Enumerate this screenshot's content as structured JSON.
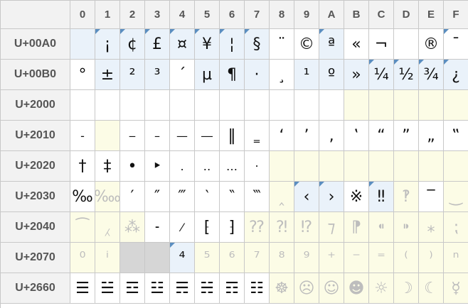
{
  "columns": [
    "0",
    "1",
    "2",
    "3",
    "4",
    "5",
    "6",
    "7",
    "8",
    "9",
    "A",
    "B",
    "C",
    "D",
    "E",
    "F"
  ],
  "rows": [
    {
      "label": "U+00A0",
      "cells": [
        {
          "glyph": "",
          "state": "mod",
          "marked": false
        },
        {
          "glyph": "¡",
          "state": "mod",
          "marked": true
        },
        {
          "glyph": "¢",
          "state": "mod",
          "marked": true
        },
        {
          "glyph": "£",
          "state": "mod",
          "marked": true
        },
        {
          "glyph": "¤",
          "state": "mod",
          "marked": true
        },
        {
          "glyph": "¥",
          "state": "mod",
          "marked": true
        },
        {
          "glyph": "¦",
          "state": "mod",
          "marked": true
        },
        {
          "glyph": "§",
          "state": "mod",
          "marked": true
        },
        {
          "glyph": "¨",
          "state": "plain",
          "marked": false
        },
        {
          "glyph": "©",
          "state": "plain",
          "marked": false
        },
        {
          "glyph": "ª",
          "state": "mod",
          "marked": true
        },
        {
          "glyph": "«",
          "state": "plain",
          "marked": false
        },
        {
          "glyph": "¬",
          "state": "plain",
          "marked": false
        },
        {
          "glyph": "",
          "state": "plain",
          "marked": false
        },
        {
          "glyph": "®",
          "state": "plain",
          "marked": false
        },
        {
          "glyph": "¯",
          "state": "plain",
          "marked": true
        }
      ]
    },
    {
      "label": "U+00B0",
      "cells": [
        {
          "glyph": "°",
          "state": "plain",
          "marked": false
        },
        {
          "glyph": "±",
          "state": "mod",
          "marked": false
        },
        {
          "glyph": "²",
          "state": "mod",
          "marked": false
        },
        {
          "glyph": "³",
          "state": "mod",
          "marked": false
        },
        {
          "glyph": "´",
          "state": "plain",
          "marked": false
        },
        {
          "glyph": "µ",
          "state": "mod",
          "marked": false
        },
        {
          "glyph": "¶",
          "state": "mod",
          "marked": false
        },
        {
          "glyph": "·",
          "state": "mod",
          "marked": false
        },
        {
          "glyph": "¸",
          "state": "plain",
          "marked": false
        },
        {
          "glyph": "¹",
          "state": "mod",
          "marked": false
        },
        {
          "glyph": "º",
          "state": "mod",
          "marked": false
        },
        {
          "glyph": "»",
          "state": "mod",
          "marked": false
        },
        {
          "glyph": "¼",
          "state": "mod",
          "marked": true
        },
        {
          "glyph": "½",
          "state": "mod",
          "marked": true
        },
        {
          "glyph": "¾",
          "state": "mod",
          "marked": true
        },
        {
          "glyph": "¿",
          "state": "mod",
          "marked": true
        }
      ]
    },
    {
      "label": "U+2000",
      "cells": [
        {
          "glyph": "",
          "state": "plain",
          "marked": false
        },
        {
          "glyph": "",
          "state": "plain",
          "marked": false
        },
        {
          "glyph": "",
          "state": "plain",
          "marked": false
        },
        {
          "glyph": "",
          "state": "plain",
          "marked": false
        },
        {
          "glyph": "",
          "state": "plain",
          "marked": false
        },
        {
          "glyph": "",
          "state": "plain",
          "marked": false
        },
        {
          "glyph": "",
          "state": "plain",
          "marked": false
        },
        {
          "glyph": "",
          "state": "plain",
          "marked": false
        },
        {
          "glyph": "",
          "state": "plain",
          "marked": false
        },
        {
          "glyph": "",
          "state": "plain",
          "marked": false
        },
        {
          "glyph": "",
          "state": "plain",
          "marked": false
        },
        {
          "glyph": "",
          "state": "unass",
          "marked": false
        },
        {
          "glyph": "",
          "state": "unass",
          "marked": false
        },
        {
          "glyph": "",
          "state": "unass",
          "marked": false
        },
        {
          "glyph": "",
          "state": "unass",
          "marked": false
        },
        {
          "glyph": "",
          "state": "unass",
          "marked": false
        }
      ]
    },
    {
      "label": "U+2010",
      "cells": [
        {
          "glyph": "‐",
          "state": "plain",
          "marked": false
        },
        {
          "glyph": "",
          "state": "unass",
          "marked": false
        },
        {
          "glyph": "‒",
          "state": "plain",
          "marked": false
        },
        {
          "glyph": "–",
          "state": "plain",
          "marked": false
        },
        {
          "glyph": "—",
          "state": "plain",
          "marked": false
        },
        {
          "glyph": "―",
          "state": "plain",
          "marked": false
        },
        {
          "glyph": "‖",
          "state": "plain",
          "marked": false
        },
        {
          "glyph": "‗",
          "state": "plain",
          "marked": false
        },
        {
          "glyph": "‘",
          "state": "plain",
          "marked": false
        },
        {
          "glyph": "’",
          "state": "plain",
          "marked": false
        },
        {
          "glyph": "‚",
          "state": "plain",
          "marked": false
        },
        {
          "glyph": "‛",
          "state": "plain",
          "marked": false
        },
        {
          "glyph": "“",
          "state": "plain",
          "marked": false
        },
        {
          "glyph": "”",
          "state": "plain",
          "marked": false
        },
        {
          "glyph": "„",
          "state": "plain",
          "marked": false
        },
        {
          "glyph": "‟",
          "state": "plain",
          "marked": false
        }
      ]
    },
    {
      "label": "U+2020",
      "cells": [
        {
          "glyph": "†",
          "state": "plain",
          "marked": false
        },
        {
          "glyph": "‡",
          "state": "plain",
          "marked": false
        },
        {
          "glyph": "•",
          "state": "plain",
          "marked": false
        },
        {
          "glyph": "‣",
          "state": "plain",
          "marked": false
        },
        {
          "glyph": "․",
          "state": "plain",
          "marked": false
        },
        {
          "glyph": "‥",
          "state": "plain",
          "marked": false
        },
        {
          "glyph": "…",
          "state": "plain",
          "marked": false
        },
        {
          "glyph": "‧",
          "state": "plain",
          "marked": false
        },
        {
          "glyph": "",
          "state": "unass",
          "marked": false
        },
        {
          "glyph": "",
          "state": "unass",
          "marked": false
        },
        {
          "glyph": "",
          "state": "unass",
          "marked": false
        },
        {
          "glyph": "",
          "state": "unass",
          "marked": false
        },
        {
          "glyph": "",
          "state": "unass",
          "marked": false
        },
        {
          "glyph": "",
          "state": "unass",
          "marked": false
        },
        {
          "glyph": "",
          "state": "unass",
          "marked": false
        },
        {
          "glyph": "",
          "state": "unass",
          "marked": false
        }
      ]
    },
    {
      "label": "U+2030",
      "cells": [
        {
          "glyph": "‰",
          "state": "plain",
          "marked": false
        },
        {
          "glyph": "‱",
          "state": "unass",
          "marked": false
        },
        {
          "glyph": "′",
          "state": "plain",
          "marked": false
        },
        {
          "glyph": "″",
          "state": "plain",
          "marked": false
        },
        {
          "glyph": "‴",
          "state": "plain",
          "marked": false
        },
        {
          "glyph": "‵",
          "state": "plain",
          "marked": false
        },
        {
          "glyph": "‶",
          "state": "plain",
          "marked": false
        },
        {
          "glyph": "‷",
          "state": "plain",
          "marked": false
        },
        {
          "glyph": "‸",
          "state": "unass",
          "marked": false
        },
        {
          "glyph": "‹",
          "state": "mod",
          "marked": true
        },
        {
          "glyph": "›",
          "state": "mod",
          "marked": true
        },
        {
          "glyph": "※",
          "state": "plain",
          "marked": false
        },
        {
          "glyph": "‼",
          "state": "mod",
          "marked": true
        },
        {
          "glyph": "‽",
          "state": "unass",
          "marked": false
        },
        {
          "glyph": "‾",
          "state": "plain",
          "marked": false
        },
        {
          "glyph": "‿",
          "state": "unass",
          "marked": false
        }
      ]
    },
    {
      "label": "U+2040",
      "cells": [
        {
          "glyph": "⁀",
          "state": "unass",
          "marked": false
        },
        {
          "glyph": "⁁",
          "state": "unass",
          "marked": false
        },
        {
          "glyph": "⁂",
          "state": "unass",
          "marked": false
        },
        {
          "glyph": "⁃",
          "state": "plain",
          "marked": false
        },
        {
          "glyph": "⁄",
          "state": "plain",
          "marked": false
        },
        {
          "glyph": "⁅",
          "state": "plain",
          "marked": false
        },
        {
          "glyph": "⁆",
          "state": "plain",
          "marked": false
        },
        {
          "glyph": "⁇",
          "state": "unass",
          "marked": false
        },
        {
          "glyph": "⁈",
          "state": "unass",
          "marked": false
        },
        {
          "glyph": "⁉",
          "state": "unass",
          "marked": false
        },
        {
          "glyph": "⁊",
          "state": "unass",
          "marked": false
        },
        {
          "glyph": "⁋",
          "state": "unass",
          "marked": false
        },
        {
          "glyph": "⁌",
          "state": "unass",
          "marked": false
        },
        {
          "glyph": "⁍",
          "state": "unass",
          "marked": false
        },
        {
          "glyph": "⁎",
          "state": "unass",
          "marked": false
        },
        {
          "glyph": "⁏",
          "state": "unass",
          "marked": false
        }
      ]
    },
    {
      "label": "U+2070",
      "cells": [
        {
          "glyph": "⁰",
          "state": "unass",
          "marked": false
        },
        {
          "glyph": "ⁱ",
          "state": "unass",
          "marked": false
        },
        {
          "glyph": "",
          "state": "gray",
          "marked": false
        },
        {
          "glyph": "",
          "state": "gray",
          "marked": false
        },
        {
          "glyph": "⁴",
          "state": "mod",
          "marked": true
        },
        {
          "glyph": "⁵",
          "state": "unass",
          "marked": false
        },
        {
          "glyph": "⁶",
          "state": "unass",
          "marked": false
        },
        {
          "glyph": "⁷",
          "state": "unass",
          "marked": false
        },
        {
          "glyph": "⁸",
          "state": "unass",
          "marked": false
        },
        {
          "glyph": "⁹",
          "state": "unass",
          "marked": false
        },
        {
          "glyph": "⁺",
          "state": "unass",
          "marked": false
        },
        {
          "glyph": "⁻",
          "state": "unass",
          "marked": false
        },
        {
          "glyph": "⁼",
          "state": "unass",
          "marked": false
        },
        {
          "glyph": "⁽",
          "state": "unass",
          "marked": false
        },
        {
          "glyph": "⁾",
          "state": "unass",
          "marked": false
        },
        {
          "glyph": "ⁿ",
          "state": "unass",
          "marked": false
        }
      ]
    },
    {
      "label": "U+2660",
      "cells": [
        {
          "glyph": "☰",
          "state": "plain",
          "marked": false
        },
        {
          "glyph": "☱",
          "state": "plain",
          "marked": false
        },
        {
          "glyph": "☲",
          "state": "plain",
          "marked": false
        },
        {
          "glyph": "☳",
          "state": "plain",
          "marked": false
        },
        {
          "glyph": "☴",
          "state": "plain",
          "marked": false
        },
        {
          "glyph": "☵",
          "state": "plain",
          "marked": false
        },
        {
          "glyph": "☶",
          "state": "plain",
          "marked": false
        },
        {
          "glyph": "☷",
          "state": "plain",
          "marked": false
        },
        {
          "glyph": "☸",
          "state": "unass",
          "marked": false
        },
        {
          "glyph": "☹",
          "state": "unass",
          "marked": false
        },
        {
          "glyph": "☺",
          "state": "unass",
          "marked": false
        },
        {
          "glyph": "☻",
          "state": "unass",
          "marked": false
        },
        {
          "glyph": "☼",
          "state": "unass",
          "marked": false
        },
        {
          "glyph": "☽",
          "state": "unass",
          "marked": false
        },
        {
          "glyph": "☾",
          "state": "unass",
          "marked": false
        },
        {
          "glyph": "☿",
          "state": "unass",
          "marked": false
        }
      ]
    }
  ]
}
